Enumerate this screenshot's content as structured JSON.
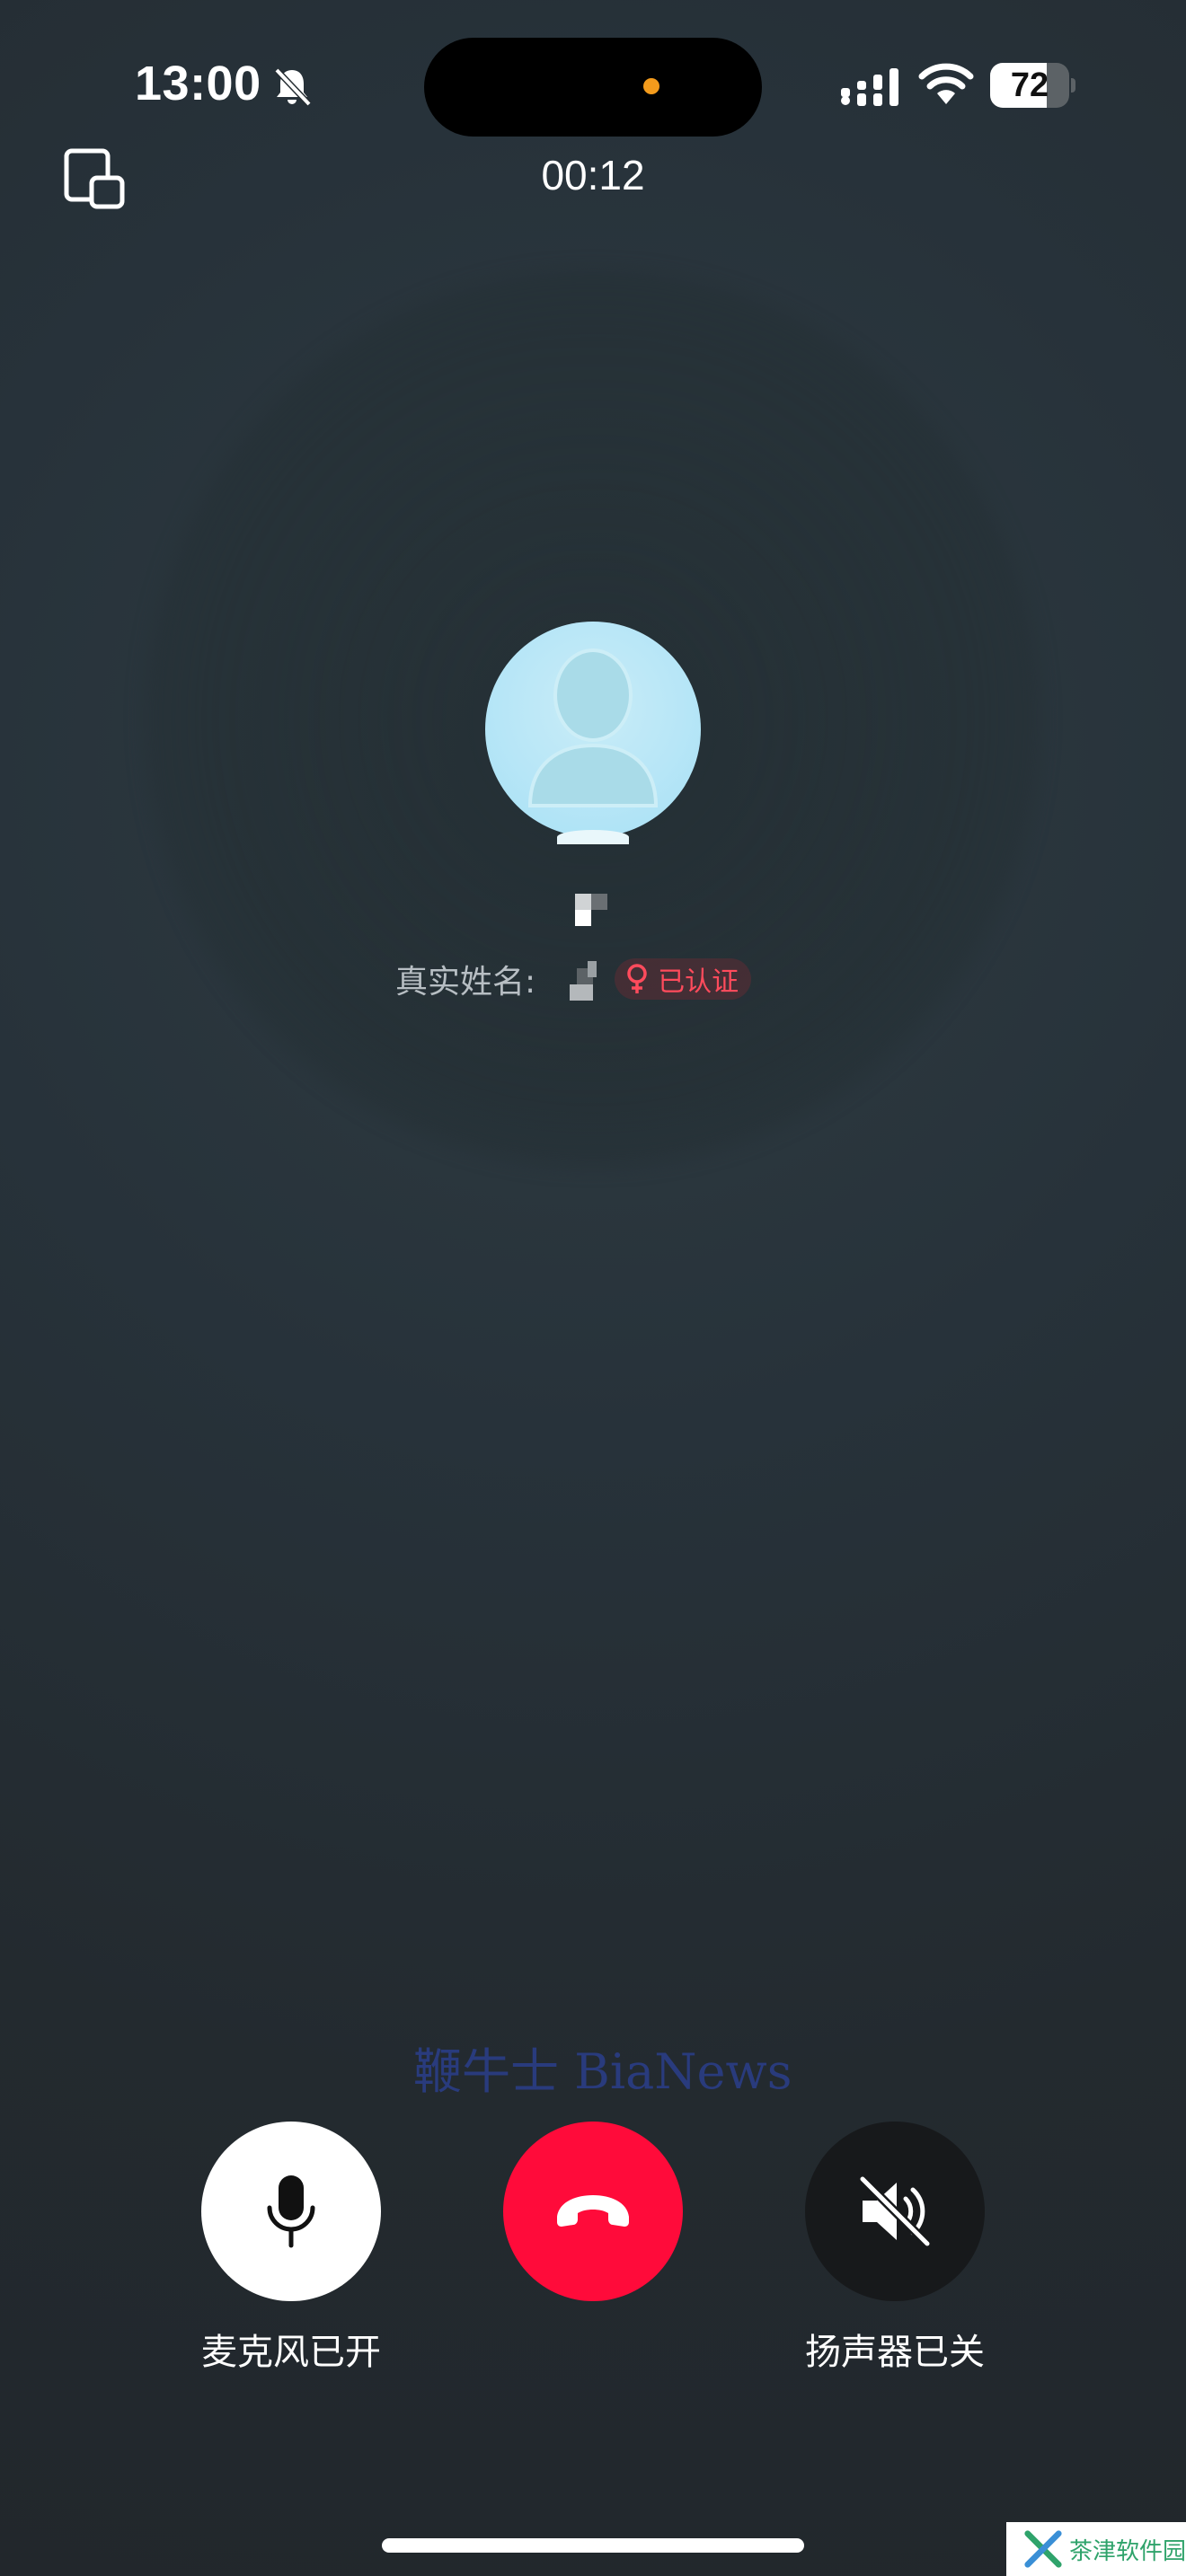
{
  "status_bar": {
    "time": "13:00",
    "battery_percent": "72",
    "battery_level": 0.72,
    "icons": [
      "bell-off-icon",
      "cellular-signal-icon",
      "wifi-icon",
      "battery-icon"
    ],
    "privacy_dot_color": "#f39b1c"
  },
  "call": {
    "timer": "00:12",
    "real_name_label": "真实姓名:",
    "verified_label": "已认证",
    "gender_icon": "female-icon",
    "badge_color": "#ff4b5c"
  },
  "watermark": "鞭牛士 BiaNews",
  "controls": {
    "mic_label": "麦克风已开",
    "speaker_label": "扬声器已关",
    "hangup_color": "#ff0b3a",
    "icons": [
      "microphone-icon",
      "hang-up-icon",
      "speaker-muted-icon"
    ]
  },
  "site_logo_text": "茶津软件园"
}
